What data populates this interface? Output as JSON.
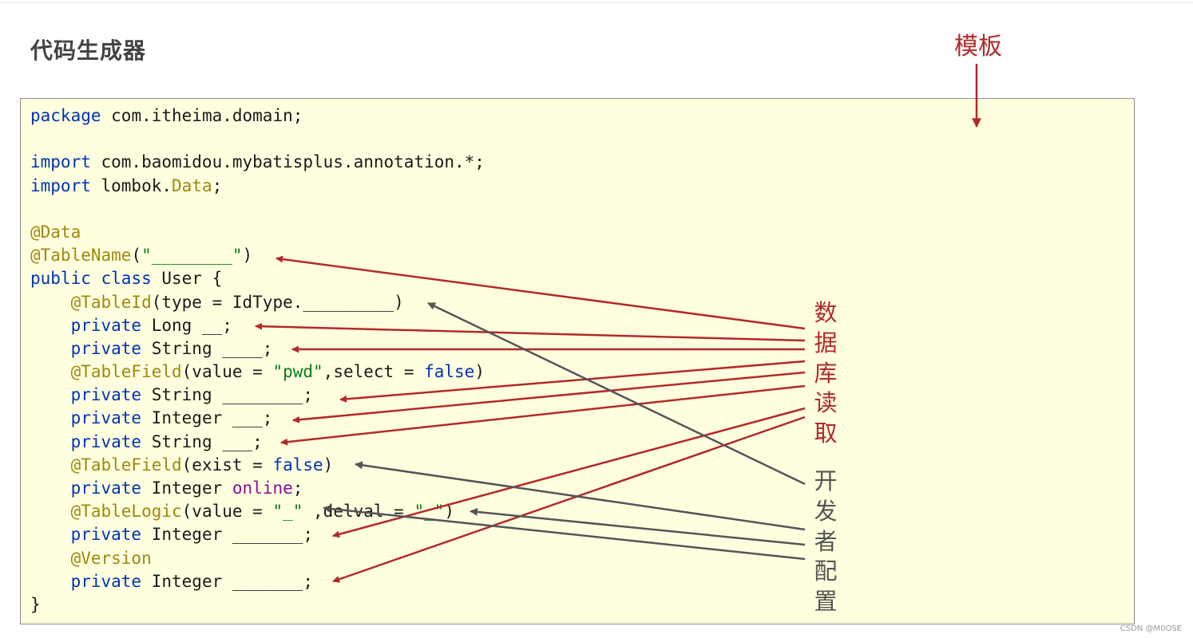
{
  "title": "代码生成器",
  "template_label": "模板",
  "code_lines": [
    [
      {
        "t": "package",
        "c": "kw"
      },
      {
        "t": " com.itheima.domain;"
      }
    ],
    [],
    [
      {
        "t": "import",
        "c": "kw"
      },
      {
        "t": " com.baomidou.mybatisplus.annotation.*;"
      }
    ],
    [
      {
        "t": "import",
        "c": "kw"
      },
      {
        "t": " lombok."
      },
      {
        "t": "Data",
        "c": "an"
      },
      {
        "t": ";"
      }
    ],
    [],
    [
      {
        "t": "@Data",
        "c": "an"
      }
    ],
    [
      {
        "t": "@TableName",
        "c": "an"
      },
      {
        "t": "("
      },
      {
        "t": "\"________\"",
        "c": "st"
      },
      {
        "t": ")"
      }
    ],
    [
      {
        "t": "public",
        "c": "kw"
      },
      {
        "t": " "
      },
      {
        "t": "class",
        "c": "kw"
      },
      {
        "t": " User {"
      }
    ],
    [
      {
        "t": "    "
      },
      {
        "t": "@TableId",
        "c": "an"
      },
      {
        "t": "(type = IdType._________)"
      }
    ],
    [
      {
        "t": "    "
      },
      {
        "t": "private",
        "c": "kw"
      },
      {
        "t": " Long __;"
      }
    ],
    [
      {
        "t": "    "
      },
      {
        "t": "private",
        "c": "kw"
      },
      {
        "t": " String ____;"
      }
    ],
    [
      {
        "t": "    "
      },
      {
        "t": "@TableField",
        "c": "an"
      },
      {
        "t": "(value = "
      },
      {
        "t": "\"pwd\"",
        "c": "st"
      },
      {
        "t": ",select = "
      },
      {
        "t": "false",
        "c": "kw"
      },
      {
        "t": ")"
      }
    ],
    [
      {
        "t": "    "
      },
      {
        "t": "private",
        "c": "kw"
      },
      {
        "t": " String ________;"
      }
    ],
    [
      {
        "t": "    "
      },
      {
        "t": "private",
        "c": "kw"
      },
      {
        "t": " Integer ___;"
      }
    ],
    [
      {
        "t": "    "
      },
      {
        "t": "private",
        "c": "kw"
      },
      {
        "t": " String ___;"
      }
    ],
    [
      {
        "t": "    "
      },
      {
        "t": "@TableField",
        "c": "an"
      },
      {
        "t": "(exist = "
      },
      {
        "t": "false",
        "c": "kw"
      },
      {
        "t": ")"
      }
    ],
    [
      {
        "t": "    "
      },
      {
        "t": "private",
        "c": "kw"
      },
      {
        "t": " Integer "
      },
      {
        "t": "online",
        "c": "pp"
      },
      {
        "t": ";"
      }
    ],
    [
      {
        "t": "    "
      },
      {
        "t": "@TableLogic",
        "c": "an"
      },
      {
        "t": "(value = "
      },
      {
        "t": "\"_\"",
        "c": "st"
      },
      {
        "t": " ,delval = "
      },
      {
        "t": "\"_\"",
        "c": "st"
      },
      {
        "t": ")"
      }
    ],
    [
      {
        "t": "    "
      },
      {
        "t": "private",
        "c": "kw"
      },
      {
        "t": " Integer _______;"
      }
    ],
    [
      {
        "t": "    "
      },
      {
        "t": "@Version",
        "c": "an"
      }
    ],
    [
      {
        "t": "    "
      },
      {
        "t": "private",
        "c": "kw"
      },
      {
        "t": " Integer _______;"
      }
    ],
    [
      {
        "t": "}"
      }
    ]
  ],
  "db_label": [
    "数",
    "据",
    "库",
    "读",
    "取"
  ],
  "dev_label": [
    "开",
    "发",
    "者",
    "配",
    "置"
  ],
  "watermark": "CSDN @M0OSE",
  "colors": {
    "red": "#b22a2a",
    "gray": "#555555",
    "code_bg": "#ffffe0"
  }
}
